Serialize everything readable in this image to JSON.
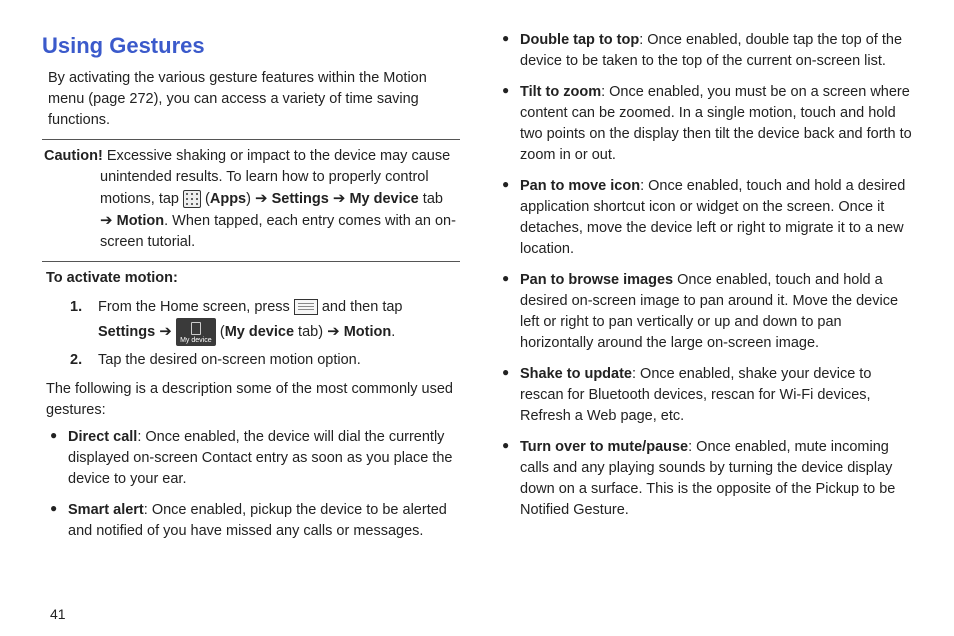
{
  "title": "Using Gestures",
  "intro": "By activating the various gesture features within the Motion menu (page 272), you can access a variety of time saving functions.",
  "caution_label": "Caution!",
  "caution_pre": " Excessive shaking or impact to the device may cause unintended results. To learn how to properly control motions, tap ",
  "apps_label": "Apps",
  "settings_label": "Settings",
  "mydevice_tab_label": "My device",
  "mydevice_icon_label": "My device",
  "tab_word": " tab ",
  "motion_label": "Motion",
  "caution_post": ". When tapped, each entry comes with an on-screen tutorial.",
  "activate_head": "To activate motion:",
  "step1_pre": "From the Home screen, press ",
  "step1_mid": " and then tap ",
  "step1_settings": "Settings",
  "step1_mydevice": "My device",
  "step1_tabword": " tab) ",
  "step1_motion": "Motion",
  "step1_end": ".",
  "step2": "Tap the desired on-screen motion option.",
  "desc": "The following is a description some of the most commonly used gestures:",
  "left_bullets": [
    {
      "bold": "Direct call",
      "text": ": Once enabled, the device will dial the currently displayed on-screen Contact entry as soon as you place the device to your ear."
    },
    {
      "bold": "Smart alert",
      "text": ": Once enabled, pickup the device to be alerted and notified of you have missed any calls or messages."
    }
  ],
  "right_bullets": [
    {
      "bold": "Double tap to top",
      "text": ": Once enabled, double tap the top of the device to be taken to the top of the current on-screen list."
    },
    {
      "bold": "Tilt to zoom",
      "text": ": Once enabled, you must be on a screen where content can be zoomed. In a single motion, touch and hold two points on the display then tilt the device back and forth to zoom in or out."
    },
    {
      "bold": "Pan to move icon",
      "text": ": Once enabled, touch and hold a desired application shortcut icon or widget on the screen. Once it detaches, move the device left or right to migrate it to a new location."
    },
    {
      "bold": "Pan to browse images",
      "text": " Once enabled, touch and hold a desired on-screen image to pan around it. Move the device left or right to pan vertically or up and down to pan horizontally around the large on-screen image."
    },
    {
      "bold": "Shake to update",
      "text": ": Once enabled, shake your device to rescan for Bluetooth devices, rescan for Wi-Fi devices, Refresh a Web page, etc."
    },
    {
      "bold": "Turn over to mute/pause",
      "text": ": Once enabled, mute incoming calls and any playing sounds by turning the device display down on a surface. This is the opposite of the Pickup to be Notified Gesture."
    }
  ],
  "page_number": "41",
  "arrow": "➔"
}
